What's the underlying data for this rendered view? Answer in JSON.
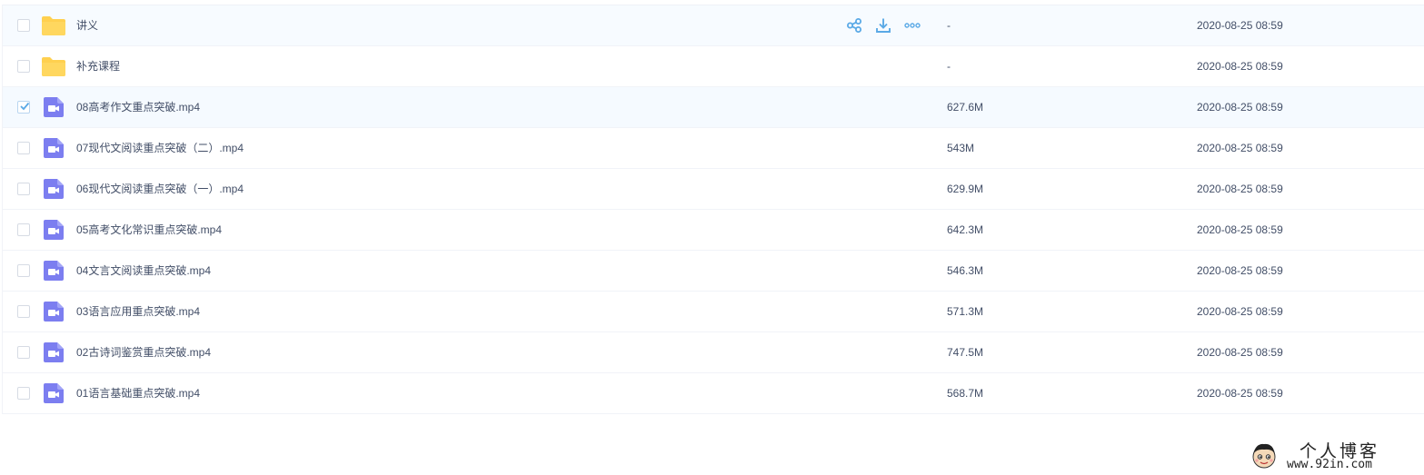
{
  "file_list": {
    "rows": [
      {
        "name": "讲义",
        "type": "folder",
        "size": "-",
        "date": "2020-08-25 08:59",
        "checked": false,
        "hover": true
      },
      {
        "name": "补充课程",
        "type": "folder",
        "size": "-",
        "date": "2020-08-25 08:59",
        "checked": false
      },
      {
        "name": "08高考作文重点突破.mp4",
        "type": "video",
        "size": "627.6M",
        "date": "2020-08-25 08:59",
        "checked": true
      },
      {
        "name": "07现代文阅读重点突破（二）.mp4",
        "type": "video",
        "size": "543M",
        "date": "2020-08-25 08:59",
        "checked": false
      },
      {
        "name": "06现代文阅读重点突破（一）.mp4",
        "type": "video",
        "size": "629.9M",
        "date": "2020-08-25 08:59",
        "checked": false
      },
      {
        "name": "05高考文化常识重点突破.mp4",
        "type": "video",
        "size": "642.3M",
        "date": "2020-08-25 08:59",
        "checked": false
      },
      {
        "name": "04文言文阅读重点突破.mp4",
        "type": "video",
        "size": "546.3M",
        "date": "2020-08-25 08:59",
        "checked": false
      },
      {
        "name": "03语言应用重点突破.mp4",
        "type": "video",
        "size": "571.3M",
        "date": "2020-08-25 08:59",
        "checked": false
      },
      {
        "name": "02古诗词鉴赏重点突破.mp4",
        "type": "video",
        "size": "747.5M",
        "date": "2020-08-25 08:59",
        "checked": false
      },
      {
        "name": "01语言基础重点突破.mp4",
        "type": "video",
        "size": "568.7M",
        "date": "2020-08-25 08:59",
        "checked": false
      }
    ],
    "row_actions": [
      {
        "icon": "share-icon"
      },
      {
        "icon": "download-icon"
      },
      {
        "icon": "more-icon"
      }
    ]
  },
  "watermark": {
    "title": "个人博客",
    "url": "www.92in.com"
  },
  "colors": {
    "folder": "#ffd04f",
    "video": "#7c7ef0",
    "action": "#5aa9e6",
    "text": "#424e67"
  }
}
